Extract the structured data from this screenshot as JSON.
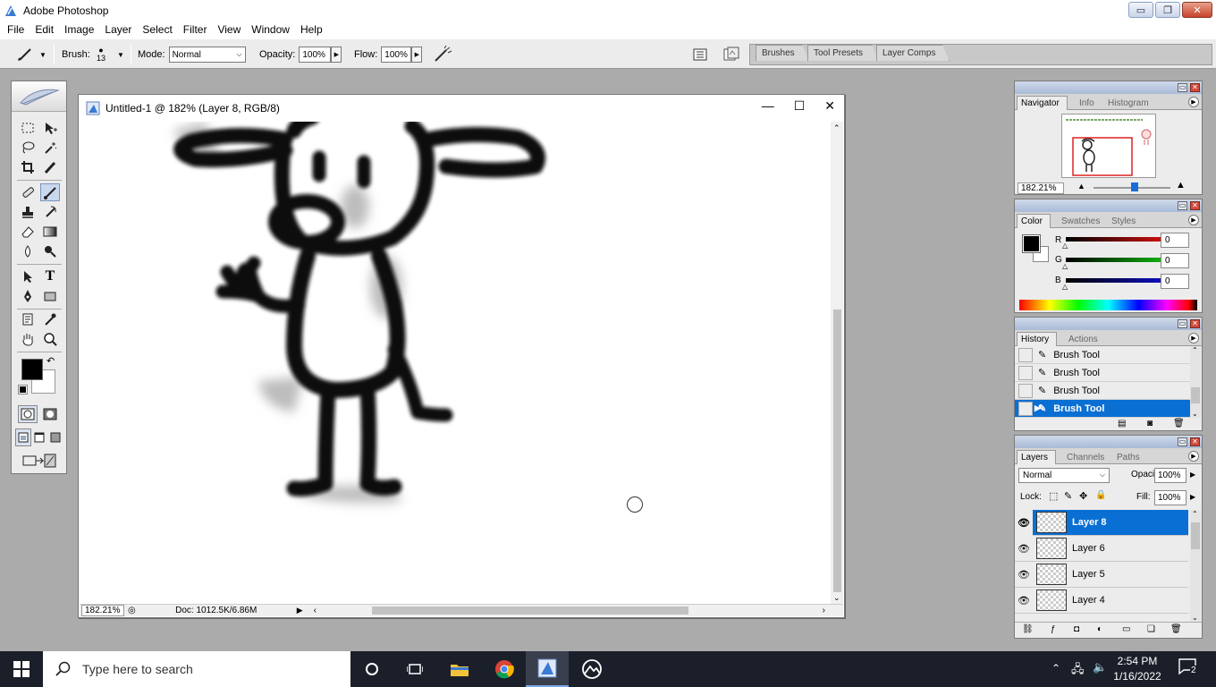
{
  "app": {
    "title": "Adobe Photoshop"
  },
  "window_controls": {
    "minimize": "▭",
    "restore": "❐",
    "close": "✕"
  },
  "menu": [
    "File",
    "Edit",
    "Image",
    "Layer",
    "Select",
    "Filter",
    "View",
    "Window",
    "Help"
  ],
  "options": {
    "brush_label": "Brush:",
    "brush_size": "13",
    "mode_label": "Mode:",
    "mode_value": "Normal",
    "opacity_label": "Opacity:",
    "opacity_value": "100%",
    "flow_label": "Flow:",
    "flow_value": "100%"
  },
  "palette_well": {
    "tabs": [
      "Brushes",
      "Tool Presets",
      "Layer Comps"
    ]
  },
  "document": {
    "title": "Untitled-1 @ 182% (Layer 8, RGB/8)",
    "zoom": "182.21%",
    "doc_size": "Doc: 1012.5K/6.86M"
  },
  "navigator": {
    "tabs": [
      "Navigator",
      "Info",
      "Histogram"
    ],
    "zoom": "182.21%"
  },
  "color": {
    "tabs": [
      "Color",
      "Swatches",
      "Styles"
    ],
    "channels": [
      {
        "label": "R",
        "value": "0",
        "color": "#e01010"
      },
      {
        "label": "G",
        "value": "0",
        "color": "#10c010"
      },
      {
        "label": "B",
        "value": "0",
        "color": "#1010d0"
      }
    ]
  },
  "history": {
    "tabs": [
      "History",
      "Actions"
    ],
    "items": [
      {
        "label": "Brush Tool"
      },
      {
        "label": "Brush Tool"
      },
      {
        "label": "Brush Tool"
      },
      {
        "label": "Brush Tool"
      }
    ]
  },
  "layers": {
    "tabs": [
      "Layers",
      "Channels",
      "Paths"
    ],
    "blend_mode": "Normal",
    "opacity_label": "Opacity:",
    "opacity_value": "100%",
    "lock_label": "Lock:",
    "fill_label": "Fill:",
    "fill_value": "100%",
    "items": [
      {
        "name": "Layer 8"
      },
      {
        "name": "Layer 6"
      },
      {
        "name": "Layer 5"
      },
      {
        "name": "Layer 4"
      }
    ]
  },
  "taskbar": {
    "search_placeholder": "Type here to search",
    "time": "2:54 PM",
    "date": "1/16/2022",
    "notification_count": "2"
  },
  "colors": {
    "selection": "#0a6fd3",
    "taskbar": "#1b1f2a"
  }
}
